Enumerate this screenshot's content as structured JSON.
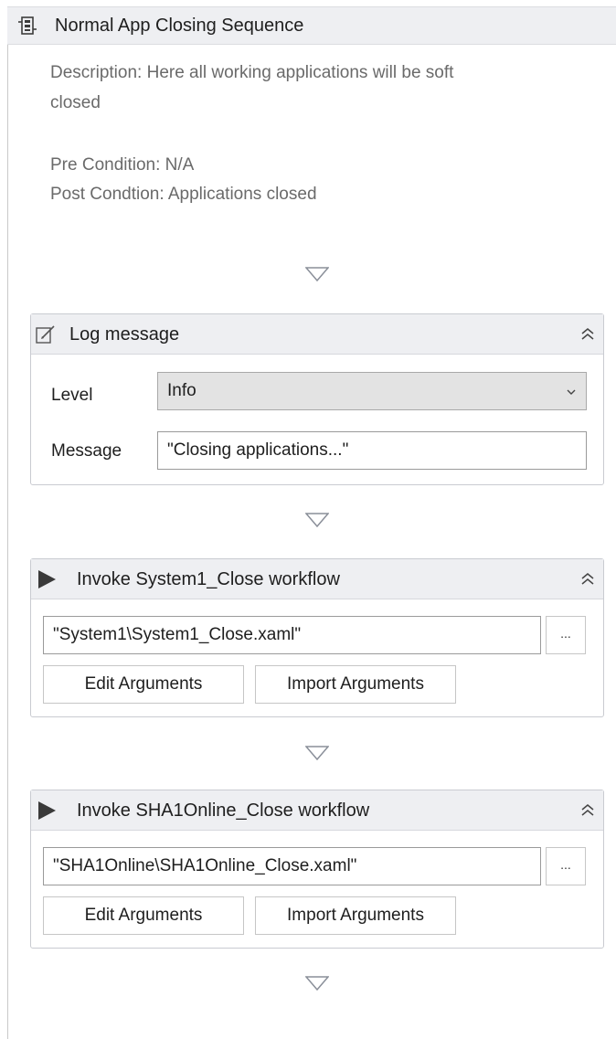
{
  "sequence": {
    "title": "Normal App Closing Sequence",
    "annotation": {
      "line1": "Description: Here all working applications will be soft",
      "line2": "closed",
      "line3": "Pre Condition: N/A",
      "line4": "Post Condtion: Applications closed"
    }
  },
  "log_message": {
    "title": "Log message",
    "level_label": "Level",
    "level_value": "Info",
    "message_label": "Message",
    "message_value": "\"Closing applications...\""
  },
  "invoke1": {
    "title": "Invoke System1_Close workflow",
    "path": "\"System1\\System1_Close.xaml\"",
    "ellipsis": "...",
    "edit_label": "Edit Arguments",
    "import_label": "Import Arguments"
  },
  "invoke2": {
    "title": "Invoke SHA1Online_Close workflow",
    "path": "\"SHA1Online\\SHA1Online_Close.xaml\"",
    "ellipsis": "...",
    "edit_label": "Edit Arguments",
    "import_label": "Import Arguments"
  },
  "icons": {
    "sequence": "sequence-icon",
    "log": "log-message-icon",
    "invoke": "play-triangle-icon",
    "collapse": "double-chevron-up-icon",
    "dropdown": "chevron-down-icon",
    "drop_target": "drop-arrow-icon"
  },
  "colors": {
    "header_bg": "#eeeff2",
    "border": "#c9cbd1",
    "annotation_text": "#6a6a6a",
    "drop_arrow": "#8a8f99"
  }
}
